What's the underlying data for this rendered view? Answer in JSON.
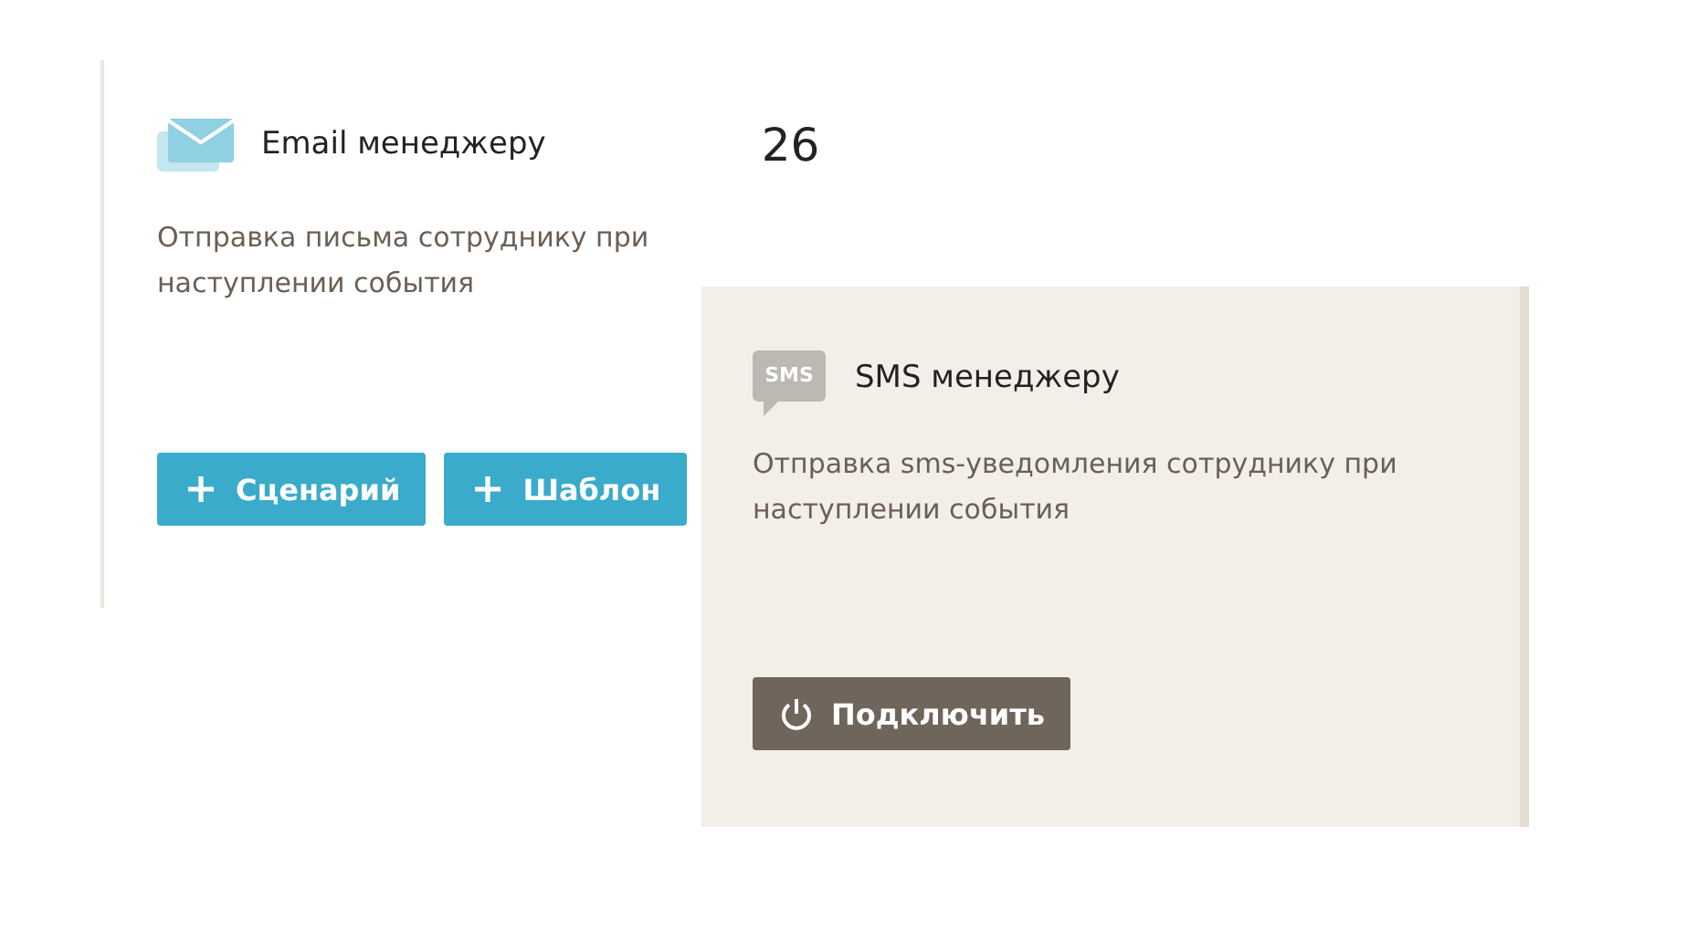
{
  "cards": [
    {
      "kind": "email",
      "title": "Email менеджеру",
      "count": "26",
      "description": "Отправка письма сотруднику при наступлении события",
      "buttons": [
        {
          "kind": "add",
          "label": "Сценарий"
        },
        {
          "kind": "add",
          "label": "Шаблон"
        }
      ]
    },
    {
      "kind": "sms",
      "icon_text": "SMS",
      "title": "SMS менеджеру",
      "description": "Отправка sms-уведомления сотруднику при наступлении события",
      "buttons": [
        {
          "kind": "power",
          "label": "Подключить"
        }
      ]
    }
  ]
}
